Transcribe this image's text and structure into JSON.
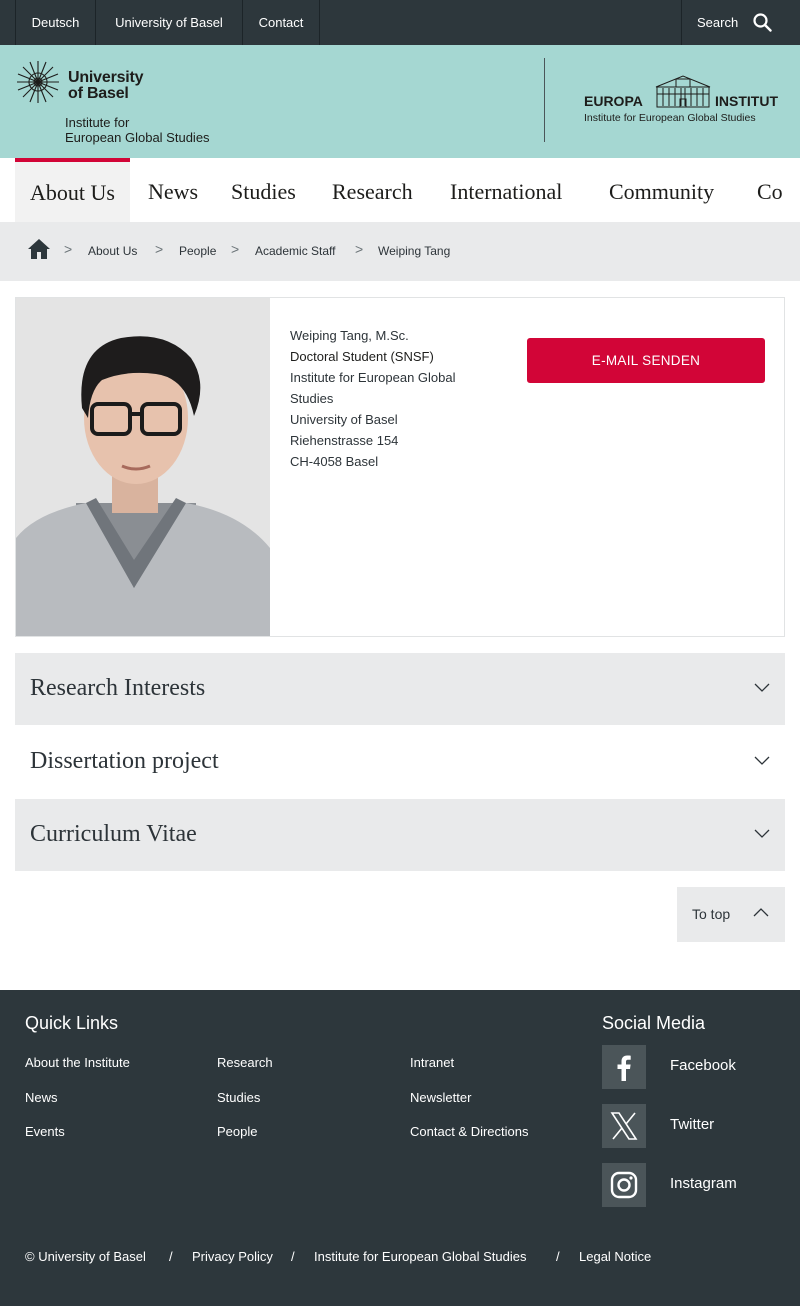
{
  "topbar": {
    "links": [
      "Deutsch",
      "University of Basel",
      "Contact"
    ],
    "search_label": "Search"
  },
  "header": {
    "university_name_line1": "University",
    "university_name_line2": "of Basel",
    "institute_line1": "Institute for",
    "institute_line2": "European Global Studies",
    "europa_left": "EUROPA",
    "europa_right": "INSTITUT",
    "europa_sub": "Institute for European Global Studies"
  },
  "mainnav": {
    "items": [
      "About Us",
      "News",
      "Studies",
      "Research",
      "International",
      "Community",
      "Co"
    ],
    "active": "About Us"
  },
  "breadcrumb": {
    "items": [
      "About Us",
      "People",
      "Academic Staff",
      "Weiping Tang"
    ]
  },
  "profile": {
    "name": "Weiping Tang, M.Sc.",
    "role": "Doctoral Student (SNSF)",
    "affiliation_line1": "Institute for European Global",
    "affiliation_line2": "Studies",
    "university": "University of Basel",
    "street": "Riehenstrasse 154",
    "city": "CH-4058 Basel",
    "email_button": "E-MAIL SENDEN"
  },
  "accordions": [
    "Research Interests",
    "Dissertation project",
    "Curriculum Vitae"
  ],
  "to_top": "To top",
  "footer": {
    "quick_links_title": "Quick Links",
    "quick_links": [
      [
        "About the Institute",
        "Research",
        "Intranet"
      ],
      [
        "News",
        "Studies",
        "Newsletter"
      ],
      [
        "Events",
        "People",
        "Contact & Directions"
      ]
    ],
    "social_title": "Social Media",
    "social": [
      "Facebook",
      "Twitter",
      "Instagram"
    ],
    "legal": [
      "© University of Basel",
      "Privacy Policy",
      "Institute for European Global Studies",
      "Legal Notice"
    ],
    "legal_separator": "/"
  },
  "colors": {
    "dark": "#2d373c",
    "mint": "#a5d7d2",
    "accent_red": "#d20537",
    "light_grey": "#e9eaeb"
  },
  "breadcrumb_separator": ">"
}
